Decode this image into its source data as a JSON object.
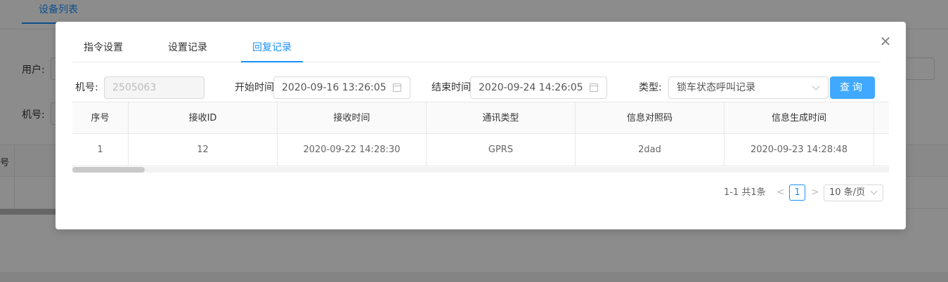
{
  "background": {
    "tab_label": "设备列表",
    "user_label": "用户:",
    "machine_label": "机号:",
    "seq_header": "号"
  },
  "modal": {
    "close_icon": "close-icon",
    "tabs": [
      {
        "label": "指令设置",
        "active": false
      },
      {
        "label": "设置记录",
        "active": false
      },
      {
        "label": "回复记录",
        "active": true
      }
    ],
    "filters": {
      "machine_label": "机号:",
      "machine_value": "2505063",
      "start_label": "开始时间",
      "start_value": "2020-09-16 13:26:05",
      "end_label": "结束时间",
      "end_value": "2020-09-24 14:26:05",
      "type_label": "类型:",
      "type_value": "锁车状态呼叫记录",
      "query_button": "查询"
    },
    "table": {
      "columns": [
        "序号",
        "接收ID",
        "接收时间",
        "通讯类型",
        "信息对照码",
        "信息生成时间"
      ],
      "rows": [
        [
          "1",
          "12",
          "2020-09-22 14:28:30",
          "GPRS",
          "2dad",
          "2020-09-23 14:28:48"
        ]
      ]
    },
    "pagination": {
      "total_text": "1-1 共1条",
      "prev": "<",
      "current_page": "1",
      "next": ">",
      "page_size": "10 条/页"
    }
  },
  "colors": {
    "accent": "#1890ff",
    "button": "#40a9ff",
    "mask": "rgba(0,0,0,0.45)"
  }
}
